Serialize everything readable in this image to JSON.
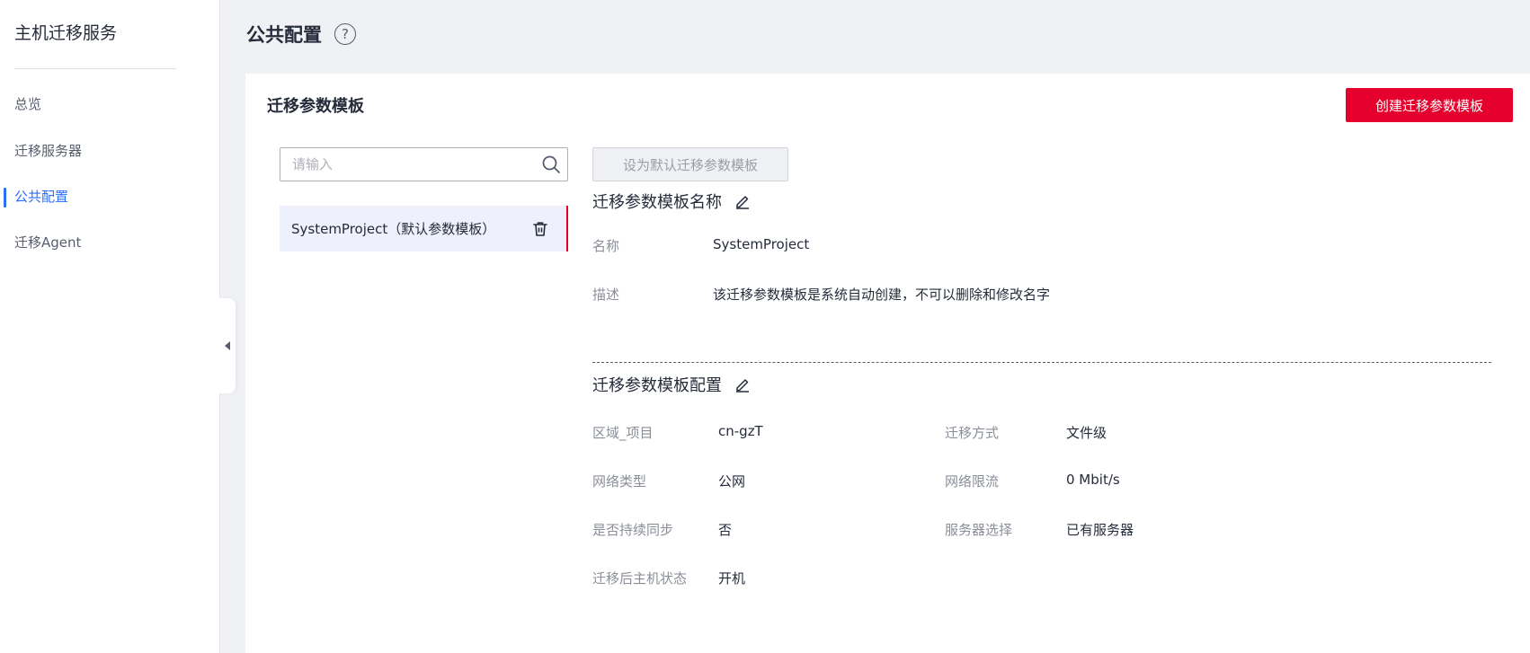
{
  "sidebar": {
    "title": "主机迁移服务",
    "items": [
      {
        "label": "总览",
        "active": false
      },
      {
        "label": "迁移服务器",
        "active": false
      },
      {
        "label": "公共配置",
        "active": true
      },
      {
        "label": "迁移Agent",
        "active": false
      }
    ]
  },
  "header": {
    "title": "公共配置",
    "help_icon": "question-circle-icon"
  },
  "card": {
    "title": "迁移参数模板",
    "create_button": "创建迁移参数模板",
    "search": {
      "placeholder": "请输入",
      "value": ""
    },
    "default_button": "设为默认迁移参数模板",
    "template_item": {
      "label": "SystemProject（默认参数模板）"
    },
    "name_section": {
      "title": "迁移参数模板名称",
      "name_label": "名称",
      "name_value": "SystemProject",
      "desc_label": "描述",
      "desc_value": "该迁移参数模板是系统自动创建，不可以删除和修改名字"
    },
    "config_section": {
      "title": "迁移参数模板配置",
      "fields": [
        {
          "label": "区域_项目",
          "value": "cn-gzT"
        },
        {
          "label": "迁移方式",
          "value": "文件级"
        },
        {
          "label": "网络类型",
          "value": "公网"
        },
        {
          "label": "网络限流",
          "value": "0 Mbit/s"
        },
        {
          "label": "是否持续同步",
          "value": "否"
        },
        {
          "label": "服务器选择",
          "value": "已有服务器"
        },
        {
          "label": "迁移后主机状态",
          "value": "开机"
        }
      ]
    }
  },
  "colors": {
    "accent_blue": "#2e6ff6",
    "primary_red": "#e6002d",
    "selected_bg": "#eef0fb",
    "page_bg": "#f0f1f5"
  }
}
